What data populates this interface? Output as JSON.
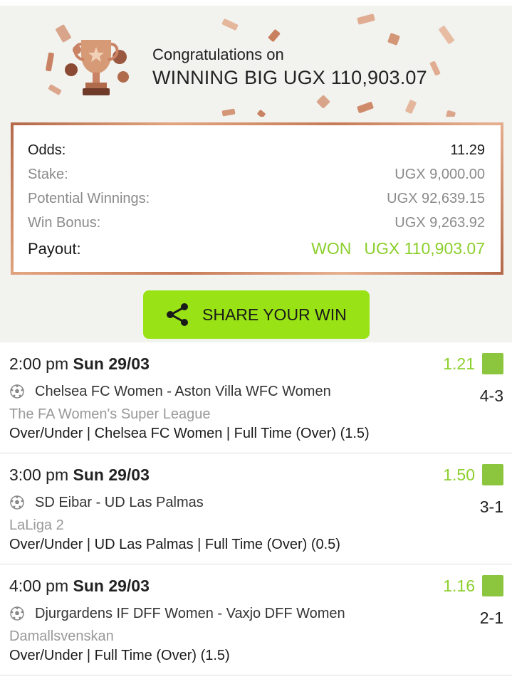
{
  "header": {
    "congrats_line1": "Congratulations on",
    "congrats_line2": "WINNING BIG UGX 110,903.07"
  },
  "summary": {
    "odds_label": "Odds:",
    "odds_value": "11.29",
    "stake_label": "Stake:",
    "stake_value": "UGX 9,000.00",
    "potential_label": "Potential Winnings:",
    "potential_value": "UGX 92,639.15",
    "bonus_label": "Win Bonus:",
    "bonus_value": "UGX 9,263.92",
    "payout_label": "Payout:",
    "payout_status": "WON",
    "payout_value": "UGX 110,903.07"
  },
  "share": {
    "label": "SHARE YOUR WIN",
    "icon": "share-icon"
  },
  "bets": [
    {
      "time": "2:00 pm",
      "date": "Sun 29/03",
      "odds": "1.21",
      "match": "Chelsea FC Women - Aston Villa WFC Women",
      "score": "4-3",
      "league": "The FA Women's Super League",
      "market": "Over/Under | Chelsea FC Women | Full Time (Over) (1.5)"
    },
    {
      "time": "3:00 pm",
      "date": "Sun 29/03",
      "odds": "1.50",
      "match": "SD Eibar - UD Las Palmas",
      "score": "3-1",
      "league": "LaLiga 2",
      "market": "Over/Under | UD Las Palmas | Full Time (Over) (0.5)"
    },
    {
      "time": "4:00 pm",
      "date": "Sun 29/03",
      "odds": "1.16",
      "match": "Djurgardens IF DFF Women - Vaxjo DFF Women",
      "score": "2-1",
      "league": "Damallsvenskan",
      "market": "Over/Under | Full Time (Over) (1.5)"
    }
  ],
  "colors": {
    "accent_green": "#99e215",
    "odds_green": "#8ccf2c",
    "status_green": "#8cc63f",
    "border_copper": "#c77b58"
  }
}
